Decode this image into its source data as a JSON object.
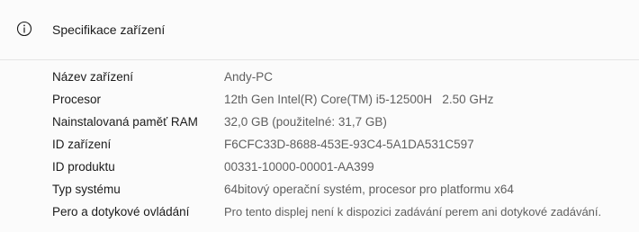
{
  "section": {
    "title": "Specifikace zařízení",
    "icon": "info-icon"
  },
  "properties": [
    {
      "label": "Název zařízení",
      "value": "Andy-PC"
    },
    {
      "label": "Procesor",
      "value": "12th Gen Intel(R) Core(TM) i5-12500H   2.50 GHz"
    },
    {
      "label": "Nainstalovaná paměť RAM",
      "value": "32,0 GB (použitelné: 31,7 GB)"
    },
    {
      "label": "ID zařízení",
      "value": "F6CFC33D-8688-453E-93C4-5A1DA531C597"
    },
    {
      "label": "ID produktu",
      "value": "00331-10000-00001-AA399"
    },
    {
      "label": "Typ systému",
      "value": "64bitový operační systém, procesor pro platformu x64"
    },
    {
      "label": "Pero a dotykové ovládání",
      "value": "Pro tento displej není k dispozici zadávání perem ani dotykové zadávání."
    }
  ]
}
